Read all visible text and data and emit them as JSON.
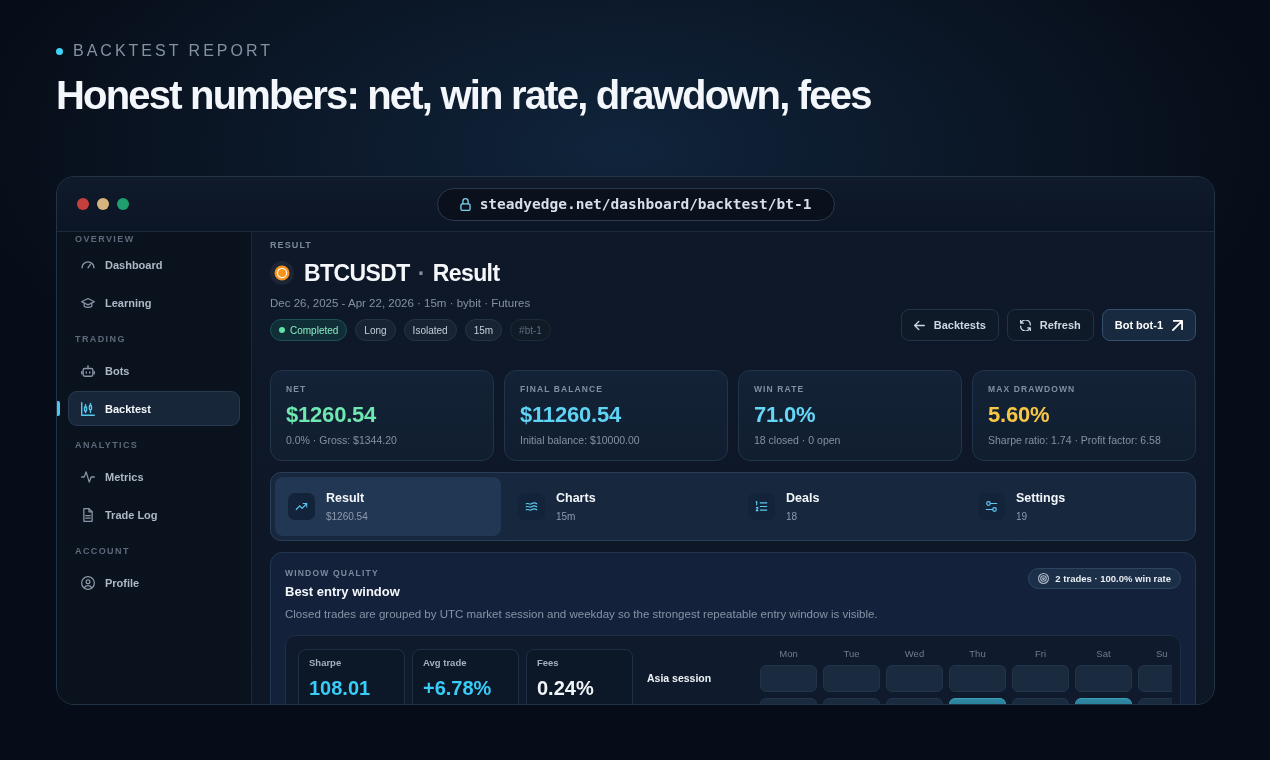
{
  "header": {
    "eyebrow": "BACKTEST REPORT",
    "title": "Honest numbers: net, win rate, drawdown, fees"
  },
  "browser": {
    "url": "steadyedge.net/dashboard/backtest/bt-1"
  },
  "sidebar": {
    "sections": [
      {
        "label": "OVERVIEW",
        "items": [
          {
            "label": "Dashboard",
            "selected": false
          },
          {
            "label": "Learning",
            "selected": false
          }
        ]
      },
      {
        "label": "TRADING",
        "items": [
          {
            "label": "Bots",
            "selected": false
          },
          {
            "label": "Backtest",
            "selected": true
          }
        ]
      },
      {
        "label": "ANALYTICS",
        "items": [
          {
            "label": "Metrics",
            "selected": false
          },
          {
            "label": "Trade Log",
            "selected": false
          }
        ]
      },
      {
        "label": "ACCOUNT",
        "items": [
          {
            "label": "Profile",
            "selected": false
          }
        ]
      }
    ]
  },
  "page": {
    "eyebrow": "RESULT",
    "symbol": "BTCUSDT",
    "separator": "·",
    "title": "Result",
    "subtitle": "Dec 26, 2025 - Apr 22, 2026 · 15m · bybit · Futures",
    "tags": [
      {
        "label": "Completed",
        "kind": "status"
      },
      {
        "label": "Long",
        "kind": "plain"
      },
      {
        "label": "Isolated",
        "kind": "plain"
      },
      {
        "label": "15m",
        "kind": "plain"
      },
      {
        "label": "#bt-1",
        "kind": "muted"
      }
    ],
    "buttons": [
      {
        "label": "Backtests",
        "kind": "secondary"
      },
      {
        "label": "Refresh",
        "kind": "secondary"
      },
      {
        "label": "Bot bot-1",
        "kind": "primary"
      }
    ]
  },
  "stats": [
    {
      "label": "NET",
      "value": "$1260.54",
      "color": "#6ee7b0",
      "note": "0.0% · Gross: $1344.20"
    },
    {
      "label": "FINAL BALANCE",
      "value": "$11260.54",
      "color": "#5fd3f3",
      "note": "Initial balance: $10000.00"
    },
    {
      "label": "WIN RATE",
      "value": "71.0%",
      "color": "#66d6f6",
      "note": "18 closed · 0 open"
    },
    {
      "label": "MAX DRAWDOWN",
      "value": "5.60%",
      "color": "#f6c644",
      "note": "Sharpe ratio: 1.74 · Profit factor: 6.58"
    }
  ],
  "tabs": [
    {
      "label": "Result",
      "sub": "$1260.54",
      "selected": true
    },
    {
      "label": "Charts",
      "sub": "15m",
      "selected": false
    },
    {
      "label": "Deals",
      "sub": "18",
      "selected": false
    },
    {
      "label": "Settings",
      "sub": "19",
      "selected": false
    }
  ],
  "window_quality": {
    "eyebrow": "WINDOW QUALITY",
    "title": "Best entry window",
    "description": "Closed trades are grouped by UTC market session and weekday so the strongest repeatable entry window is visible.",
    "badge": "2 trades · 100.0% win rate",
    "metrics": [
      {
        "label": "Sharpe",
        "value": "108.01",
        "color": "#37cdf7"
      },
      {
        "label": "Avg trade",
        "value": "+6.78%",
        "color": "#37cdf7"
      },
      {
        "label": "Fees",
        "value": "0.24%",
        "color": "#f1f5f9"
      }
    ],
    "session_grid": {
      "days": [
        "Mon",
        "Tue",
        "Wed",
        "Thu",
        "Fri",
        "Sat",
        "Su"
      ],
      "rows": [
        {
          "label": "Asia session",
          "cells": [
            {
              "highlighted": false
            },
            {
              "highlighted": false
            },
            {
              "highlighted": false
            },
            {
              "highlighted": false
            },
            {
              "highlighted": false
            },
            {
              "highlighted": false
            },
            {
              "highlighted": false
            }
          ]
        },
        {
          "cells": [
            {
              "highlighted": false
            },
            {
              "highlighted": false
            },
            {
              "highlighted": false
            },
            {
              "highlighted": true
            },
            {
              "highlighted": false
            },
            {
              "highlighted": true
            },
            {
              "highlighted": false
            }
          ]
        }
      ]
    }
  }
}
